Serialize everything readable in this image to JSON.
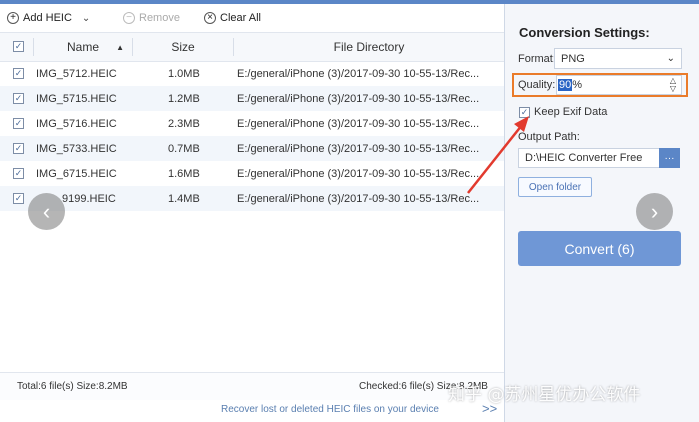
{
  "toolbar": {
    "add_label": "Add HEIC",
    "remove_label": "Remove",
    "clear_label": "Clear All"
  },
  "table": {
    "headers": {
      "name": "Name",
      "size": "Size",
      "dir": "File Directory"
    },
    "rows": [
      {
        "name": "IMG_5712.HEIC",
        "size": "1.0MB",
        "dir": "E:/general/iPhone (3)/2017-09-30 10-55-13/Rec..."
      },
      {
        "name": "IMG_5715.HEIC",
        "size": "1.2MB",
        "dir": "E:/general/iPhone (3)/2017-09-30 10-55-13/Rec..."
      },
      {
        "name": "IMG_5716.HEIC",
        "size": "2.3MB",
        "dir": "E:/general/iPhone (3)/2017-09-30 10-55-13/Rec..."
      },
      {
        "name": "IMG_5733.HEIC",
        "size": "0.7MB",
        "dir": "E:/general/iPhone (3)/2017-09-30 10-55-13/Rec..."
      },
      {
        "name": "IMG_6715.HEIC",
        "size": "1.6MB",
        "dir": "E:/general/iPhone (3)/2017-09-30 10-55-13/Rec..."
      },
      {
        "name": "9199.HEIC",
        "size": "1.4MB",
        "dir": "E:/general/iPhone (3)/2017-09-30 10-55-13/Rec..."
      }
    ]
  },
  "status": {
    "total": "Total:6 file(s) Size:8.2MB",
    "checked": "Checked:6 file(s) Size:8.2MB"
  },
  "footer": {
    "link": "Recover lost or deleted HEIC files on your device",
    "chevron": ">>"
  },
  "settings": {
    "title": "Conversion Settings:",
    "format_label": "Format:",
    "format_value": "PNG",
    "quality_label": "Quality:",
    "quality_value_selected": "90",
    "quality_suffix": "%",
    "keep_exif_label": "Keep Exif Data",
    "output_label": "Output Path:",
    "output_path": "D:\\HEIC Converter Free",
    "browse_label": "···",
    "open_folder_label": "Open folder",
    "convert_label": "Convert (6)"
  },
  "watermark": "知乎 @苏州星优办公软件",
  "colors": {
    "accent": "#5b86c7",
    "convert_button": "#6f97d6",
    "highlight_box": "#ea7b2a",
    "arrow": "#e23a2e"
  }
}
